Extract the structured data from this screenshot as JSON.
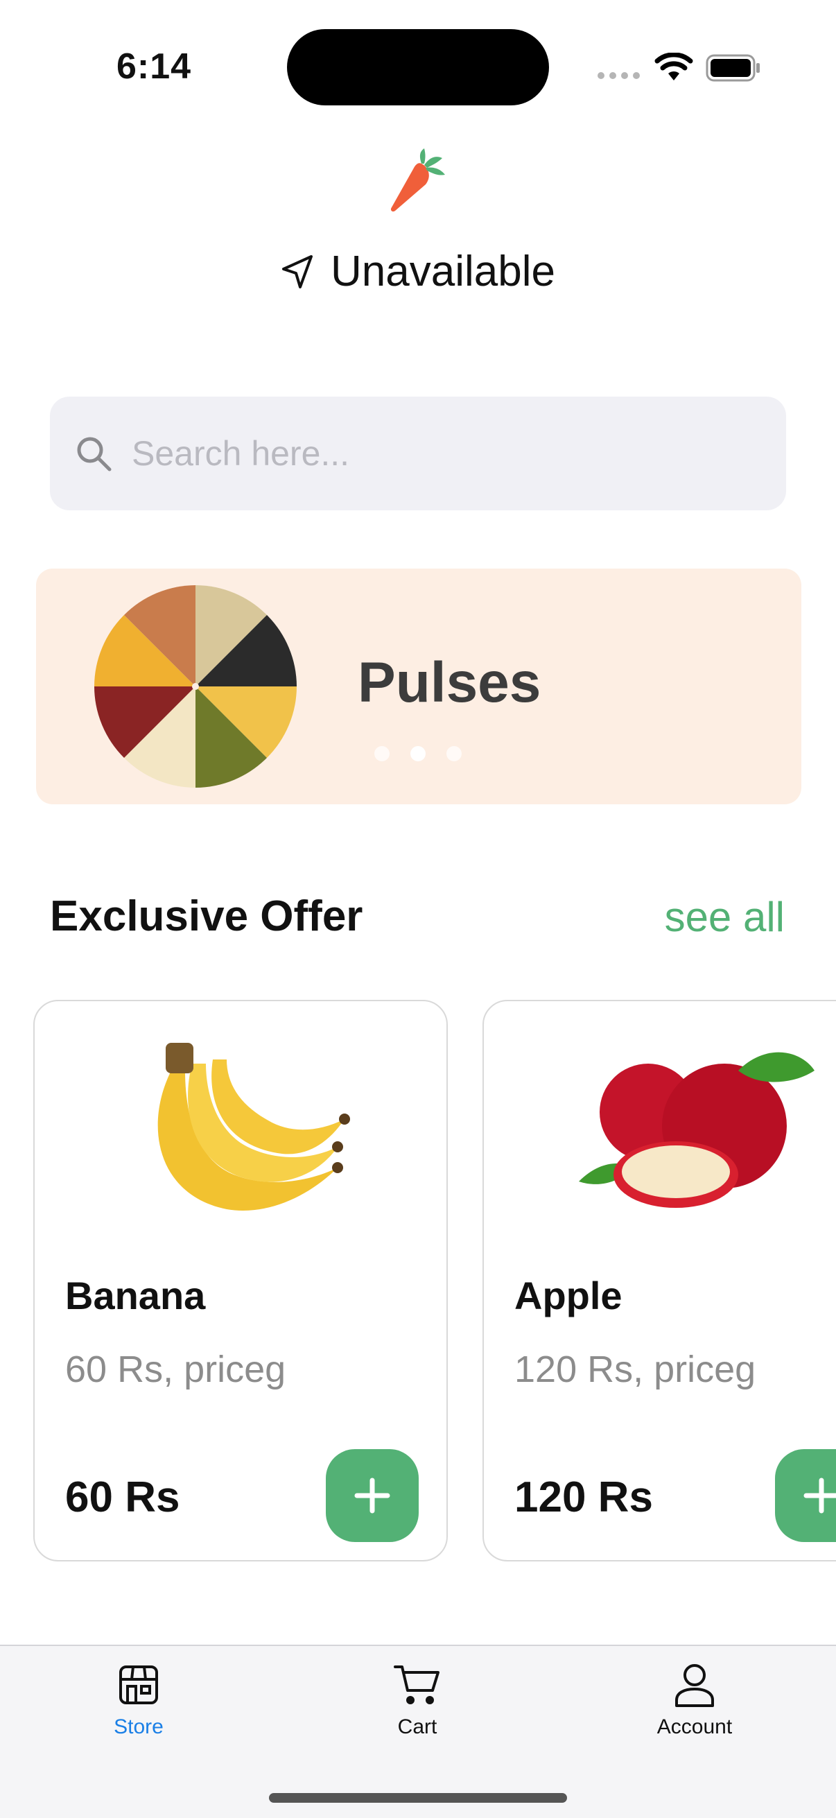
{
  "status_bar": {
    "time": "6:14"
  },
  "header": {
    "location_text": "Unavailable"
  },
  "search": {
    "placeholder": "Search here..."
  },
  "banner": {
    "title": "Pulses",
    "slide_count": 3,
    "active_slide": 2
  },
  "section": {
    "title": "Exclusive Offer",
    "see_all_label": "see all"
  },
  "products": [
    {
      "name": "Banana",
      "unit": "60 Rs, priceg",
      "price": "60 Rs"
    },
    {
      "name": "Apple",
      "unit": "120 Rs, priceg",
      "price": "120 Rs"
    }
  ],
  "tabs": [
    {
      "label": "Store",
      "active": true
    },
    {
      "label": "Cart",
      "active": false
    },
    {
      "label": "Account",
      "active": false
    }
  ],
  "colors": {
    "accent_green": "#53b175",
    "active_tab_blue": "#1a7fe6",
    "banner_bg": "#fdeee3",
    "search_bg": "#f0f0f5"
  },
  "icons": [
    "carrot-logo",
    "navigation-arrow-icon",
    "search-icon",
    "plus-icon",
    "store-icon",
    "cart-icon",
    "account-icon"
  ]
}
